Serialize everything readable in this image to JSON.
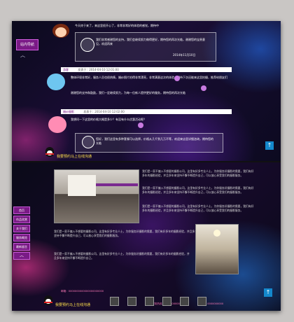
{
  "chat": {
    "side_tab": "站内导航",
    "intro": "今天终于来了，来这里很开心了，非常非常好的体验的感觉，期待中",
    "reply1": "我们非常感谢您的支持，我们会继续努力做得更好，期待您的再次光临，谢谢您的宝贵意见，欢迎再来",
    "reply1_time": "2014年11月10日",
    "msg2_name": "游客",
    "msg2_date": "发表于：2014-04-10 12:01:00",
    "msg2_text": "整体环境非常好，服务人员也很热情，婚纱照片拍得非常漂亮，非常满意这次的体验，期待下次还能来这里拍摄，推荐给朋友们",
    "msg2_reply": "谢谢您的支持和鼓励，我们一定继续努力，为每一位新人提供更好的服务，期待您的再次光临",
    "msg3_name": "婚纱摄影",
    "msg3_date": "发表于：2014-04-10 12:02:00",
    "msg3_text": "我想问一下这里的价格大概是多少？有没有什么优惠活动呢？",
    "msg3_reply": "您好，我们这里有多种套餐可以选择，价格从几千到几万不等，欢迎来店里详细咨询，期待您的光临",
    "footer": "我要预约马上在线沟通"
  },
  "page": {
    "menu": [
      "首页",
      "作品欣赏",
      "关于我们",
      "服务概览",
      "最新留言"
    ],
    "para1": "我们是一家不偏入不想要的摄影公司，这里有好多专业人士，为你服务好摄影的需要，我们有好多年的摄影经验，并且多年来坚持不懈不断提升自己，可以放心享受我们的摄影服务。",
    "para2": "我们是一家不偏入不想要的摄影公司，这里有好多专业人士，为你服务好摄影的需要，我们有好多年的摄影经验，并且多年来坚持不懈不断提升自己，可以放心享受我们的摄影服务。",
    "para3": "我们是一家不偏入不想要的摄影公司，这里有好多专业人士，为你服务好摄影的需要，我们有好多年的摄影经验，并且多年来坚持不懈不断提升自己，可以放心享受我们的摄影服务。",
    "para4": "我们是一家不偏入不想要的摄影公司，这里有好多专业人士，为你服务好摄影的需要，我们有好多年的摄影经验，并且多年来坚持不懈不断提升自己，可以放心享受我们的摄影服务。",
    "para5": "我们是一家不偏入不想要的摄影公司，这里有好多专业人士，为你服务好摄影的需要，我们有好多年的摄影经验，并且多年来坚持不懈不断提升自己。",
    "footer": "我要预约马上在线沟通"
  },
  "contact": {
    "email": "邮箱：0000000000000000000000",
    "tel": "服务热线：0750-0000000",
    "qq": "QQ：0000000000"
  },
  "colors": {
    "accent": "#7a1a86",
    "footer_text": "#ffe04b",
    "footer_info": "#ff7ab8",
    "scroll": "#1488cc"
  }
}
